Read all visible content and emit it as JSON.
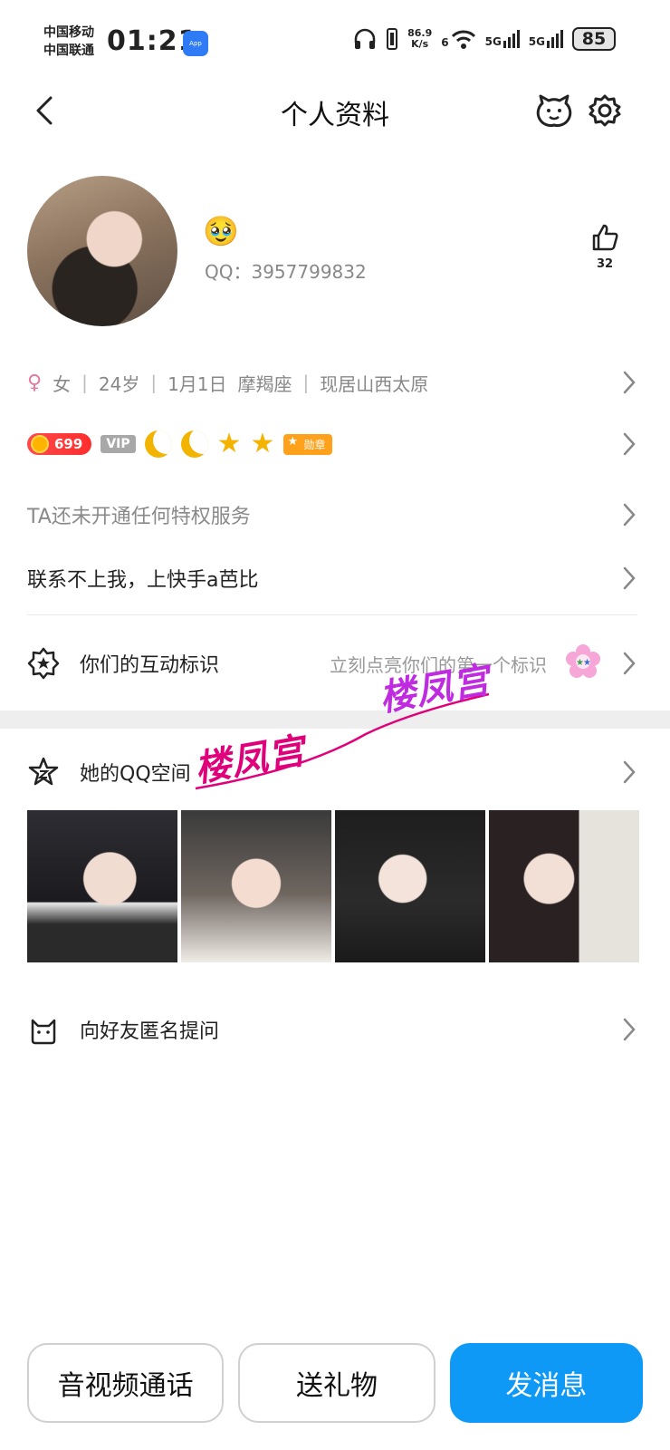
{
  "status_bar": {
    "carrier_1": "中国移动",
    "carrier_2": "中国联通",
    "time": "01:21",
    "app_badge": "App Market",
    "net_speed_value": "86.9",
    "net_speed_unit": "K/s",
    "wifi_label": "6",
    "signal_1": "5G",
    "signal_2": "5G",
    "battery": "85"
  },
  "nav": {
    "title": "个人资料"
  },
  "profile": {
    "emoji": "🥹",
    "qq_label": "QQ：",
    "qq_number": "3957799832",
    "likes": "32"
  },
  "info": {
    "gender": "女",
    "age": "24岁",
    "birthday": "1月1日",
    "zodiac": "摩羯座",
    "location": "现居山西太原"
  },
  "badges": {
    "level": "699",
    "vip": "VIP",
    "medal": "勋章"
  },
  "privilege": "TA还未开通任何特权服务",
  "signature": "联系不上我，上快手a芭比",
  "interaction": {
    "label": "你们的互动标识",
    "hint": "立刻点亮你们的第一个标识"
  },
  "qzone": {
    "label": "她的QQ空间"
  },
  "watermark": {
    "text_1": "楼凤宫",
    "text_2": "楼凤宫"
  },
  "anonymous": {
    "label": "向好友匿名提问"
  },
  "actions": {
    "call": "音视频通话",
    "gift": "送礼物",
    "message": "发消息"
  },
  "colors": {
    "primary": "#0f99f6",
    "watermark": "#e0007a",
    "level_badge": "#ff2d2d"
  }
}
